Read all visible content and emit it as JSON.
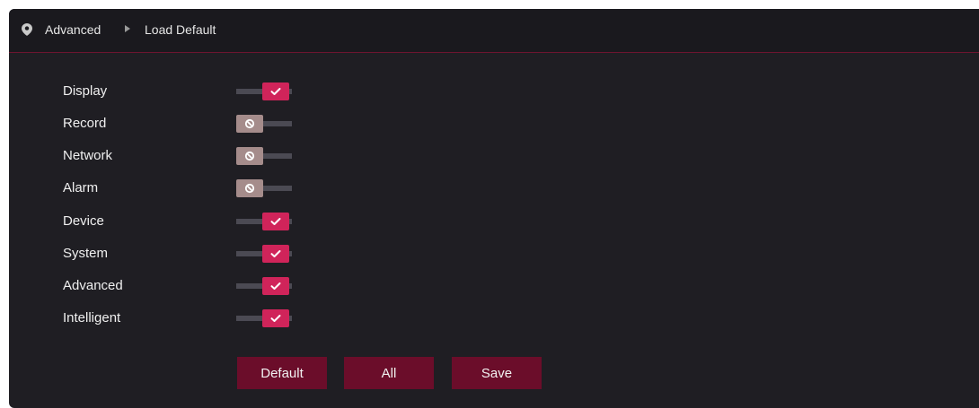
{
  "breadcrumb": {
    "items": [
      "Advanced",
      "Load Default"
    ]
  },
  "options": [
    {
      "label": "Display",
      "enabled": true
    },
    {
      "label": "Record",
      "enabled": false
    },
    {
      "label": "Network",
      "enabled": false
    },
    {
      "label": "Alarm",
      "enabled": false
    },
    {
      "label": "Device",
      "enabled": true
    },
    {
      "label": "System",
      "enabled": true
    },
    {
      "label": "Advanced",
      "enabled": true
    },
    {
      "label": "Intelligent",
      "enabled": true
    }
  ],
  "buttons": {
    "default_label": "Default",
    "all_label": "All",
    "save_label": "Save"
  },
  "colors": {
    "accent": "#d0245a",
    "button": "#6b0d2a",
    "background": "#1f1e23"
  },
  "icons": {
    "location": "location-pin-icon",
    "separator": "caret-right-icon",
    "on": "check-icon",
    "off": "blocked-icon"
  }
}
